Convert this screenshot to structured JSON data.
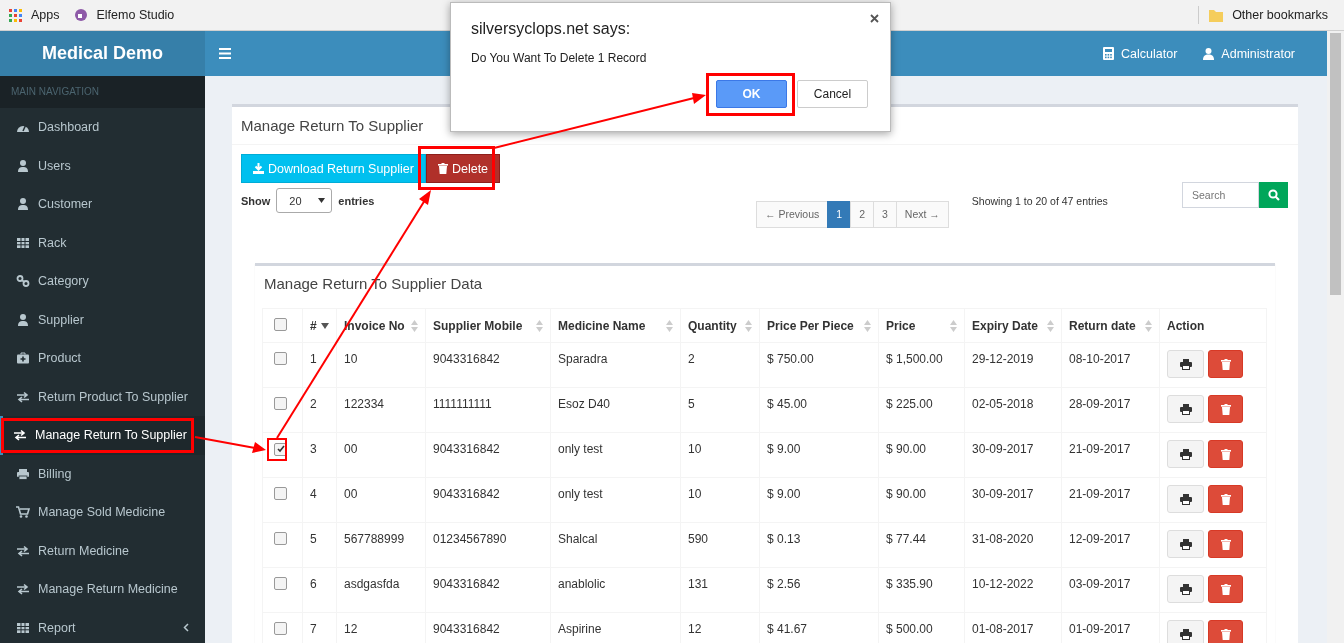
{
  "browser_bar": {
    "bookmarks": [
      {
        "label": "Apps",
        "kind": "apps"
      },
      {
        "label": "Elfemo Studio",
        "kind": "site"
      }
    ],
    "other_bookmarks": "Other bookmarks"
  },
  "header": {
    "brand": "Medical Demo",
    "links": [
      {
        "label": "Calculator",
        "kind": "calculator"
      },
      {
        "label": "Administrator",
        "kind": "user"
      }
    ]
  },
  "sidebar": {
    "heading": "MAIN NAVIGATION",
    "items": [
      {
        "label": "Dashboard",
        "selected": false,
        "submenu": false
      },
      {
        "label": "Users",
        "selected": false,
        "submenu": false
      },
      {
        "label": "Customer",
        "selected": false,
        "submenu": false
      },
      {
        "label": "Rack",
        "selected": false,
        "submenu": false
      },
      {
        "label": "Category",
        "selected": false,
        "submenu": false
      },
      {
        "label": "Supplier",
        "selected": false,
        "submenu": false
      },
      {
        "label": "Product",
        "selected": false,
        "submenu": false
      },
      {
        "label": "Return Product To Supplier",
        "selected": false,
        "submenu": false
      },
      {
        "label": "Manage Return To Supplier",
        "selected": true,
        "submenu": false
      },
      {
        "label": "Billing",
        "selected": false,
        "submenu": false
      },
      {
        "label": "Manage Sold Medicine",
        "selected": false,
        "submenu": false
      },
      {
        "label": "Return Medicine",
        "selected": false,
        "submenu": false
      },
      {
        "label": "Manage Return Medicine",
        "selected": false,
        "submenu": false
      },
      {
        "label": "Report",
        "selected": false,
        "submenu": true
      }
    ]
  },
  "page": {
    "title": "Manage Return To Supplier",
    "buttons": [
      {
        "label": "Download Return Supplier",
        "kind": "download"
      },
      {
        "label": "Delete",
        "kind": "delete"
      }
    ],
    "length": {
      "before": "Show",
      "value": "20",
      "after": "entries"
    },
    "pagination": [
      {
        "label": "← Previous",
        "selected": false
      },
      {
        "label": "1",
        "selected": true
      },
      {
        "label": "2",
        "selected": false
      },
      {
        "label": "3",
        "selected": false
      },
      {
        "label": "Next →",
        "selected": false
      }
    ],
    "info": "Showing 1 to 20 of 47 entries",
    "search": {
      "placeholder": "Search"
    }
  },
  "table_box": {
    "title": "Manage Return To Supplier Data",
    "select_all": {
      "checked": false
    },
    "columns": [
      {
        "label": "#",
        "sortable": true,
        "sorted": true
      },
      {
        "label": "Invoice No",
        "sortable": true,
        "sorted": false
      },
      {
        "label": "Supplier Mobile",
        "sortable": true,
        "sorted": false
      },
      {
        "label": "Medicine Name",
        "sortable": true,
        "sorted": false
      },
      {
        "label": "Quantity",
        "sortable": true,
        "sorted": false
      },
      {
        "label": "Price Per Piece",
        "sortable": true,
        "sorted": false
      },
      {
        "label": "Price",
        "sortable": true,
        "sorted": false
      },
      {
        "label": "Expiry Date",
        "sortable": true,
        "sorted": false
      },
      {
        "label": "Return date",
        "sortable": true,
        "sorted": false
      },
      {
        "label": "Action",
        "sortable": false
      }
    ],
    "rows": [
      {
        "checked": false,
        "cells": [
          "1",
          "10",
          "9043316842",
          "Sparadra",
          "2",
          "$ 750.00",
          "$ 1,500.00",
          "29-12-2019",
          "08-10-2017"
        ]
      },
      {
        "checked": false,
        "cells": [
          "2",
          "122334",
          "1111111111",
          "Esoz D40",
          "5",
          "$ 45.00",
          "$ 225.00",
          "02-05-2018",
          "28-09-2017"
        ]
      },
      {
        "checked": true,
        "cells": [
          "3",
          "00",
          "9043316842",
          "only test",
          "10",
          "$ 9.00",
          "$ 90.00",
          "30-09-2017",
          "21-09-2017"
        ]
      },
      {
        "checked": false,
        "cells": [
          "4",
          "00",
          "9043316842",
          "only test",
          "10",
          "$ 9.00",
          "$ 90.00",
          "30-09-2017",
          "21-09-2017"
        ]
      },
      {
        "checked": false,
        "cells": [
          "5",
          "567788999",
          "01234567890",
          "Shalcal",
          "590",
          "$ 0.13",
          "$ 77.44",
          "31-08-2020",
          "12-09-2017"
        ]
      },
      {
        "checked": false,
        "cells": [
          "6",
          "asdgasfda",
          "9043316842",
          "anablolic",
          "131",
          "$ 2.56",
          "$ 335.90",
          "10-12-2022",
          "03-09-2017"
        ]
      },
      {
        "checked": false,
        "cells": [
          "7",
          "12",
          "9043316842",
          "Aspirine",
          "12",
          "$ 41.67",
          "$ 500.00",
          "01-08-2017",
          "01-09-2017"
        ]
      }
    ]
  },
  "dialog": {
    "title": "silversyclops.net says:",
    "message": "Do You Want To Delete 1 Record",
    "buttons": [
      {
        "label": "OK",
        "primary": true
      },
      {
        "label": "Cancel",
        "primary": false
      }
    ]
  }
}
